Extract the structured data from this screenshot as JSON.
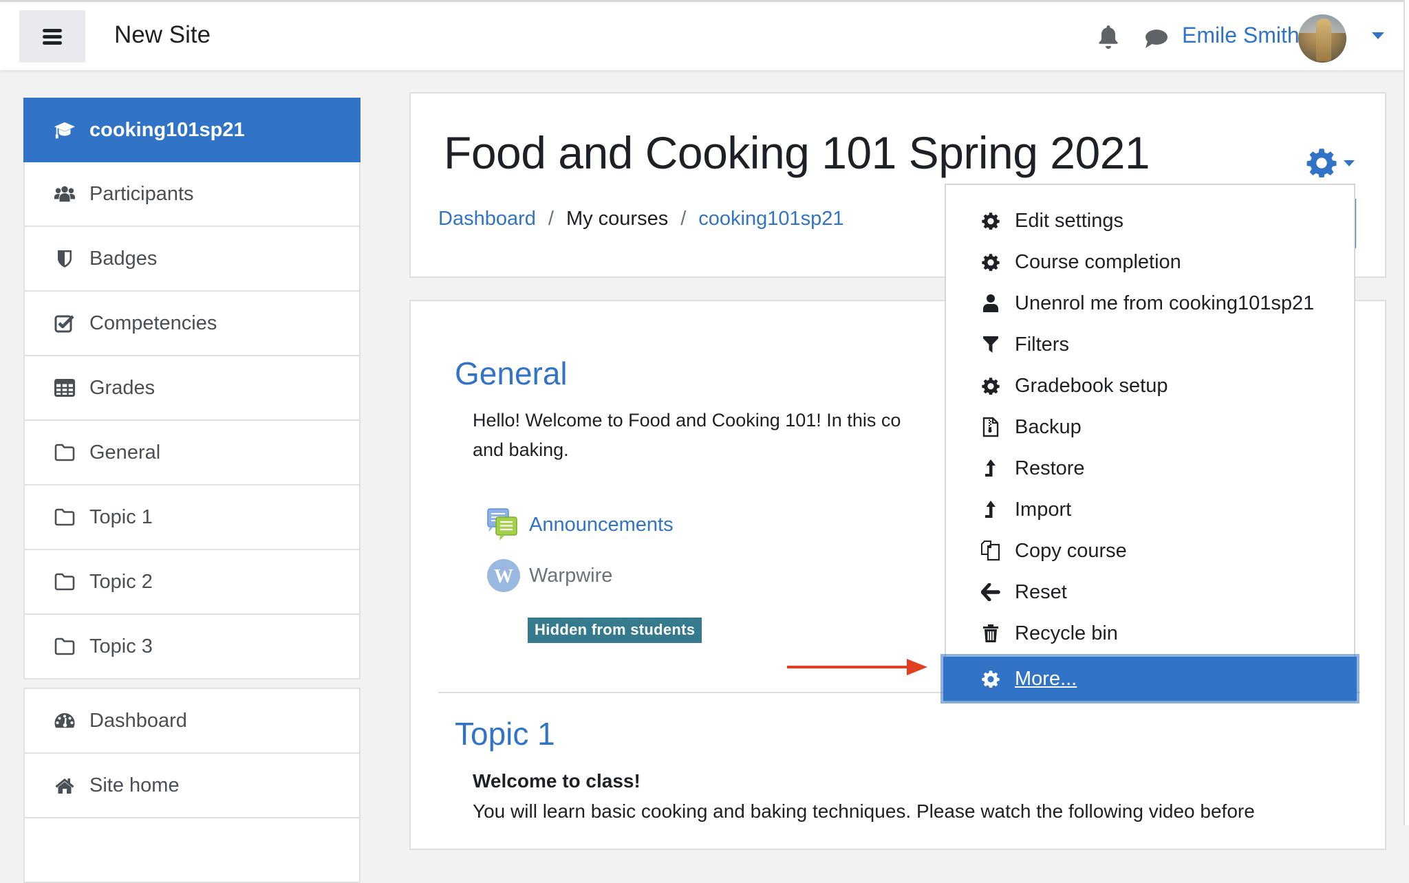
{
  "navbar": {
    "site_name": "New Site",
    "user_name": "Emile Smith",
    "icons": [
      "hamburger-icon",
      "bell-icon",
      "chat-icon",
      "avatar",
      "caret-down-icon"
    ]
  },
  "sidebar": {
    "course_items": [
      {
        "label": "cooking101sp21",
        "icon": "graduation-cap-icon",
        "active": true
      },
      {
        "label": "Participants",
        "icon": "users-icon"
      },
      {
        "label": "Badges",
        "icon": "shield-icon"
      },
      {
        "label": "Competencies",
        "icon": "check-square-icon"
      },
      {
        "label": "Grades",
        "icon": "table-icon"
      },
      {
        "label": "General",
        "icon": "folder-icon"
      },
      {
        "label": "Topic 1",
        "icon": "folder-icon"
      },
      {
        "label": "Topic 2",
        "icon": "folder-icon"
      },
      {
        "label": "Topic 3",
        "icon": "folder-icon"
      }
    ],
    "site_items": [
      {
        "label": "Dashboard",
        "icon": "dashboard-icon"
      },
      {
        "label": "Site home",
        "icon": "home-icon"
      }
    ]
  },
  "header": {
    "title": "Food and Cooking 101 Spring 2021",
    "breadcrumb": [
      {
        "label": "Dashboard",
        "link": true
      },
      {
        "label": "My courses",
        "link": false
      },
      {
        "label": "cooking101sp21",
        "link": true
      }
    ],
    "separator": "/"
  },
  "course_menu": {
    "items": [
      {
        "label": "Edit settings",
        "icon": "gear-icon"
      },
      {
        "label": "Course completion",
        "icon": "gear-icon"
      },
      {
        "label": "Unenrol me from cooking101sp21",
        "icon": "user-icon"
      },
      {
        "label": "Filters",
        "icon": "filter-icon"
      },
      {
        "label": "Gradebook setup",
        "icon": "gear-icon"
      },
      {
        "label": "Backup",
        "icon": "file-archive-icon"
      },
      {
        "label": "Restore",
        "icon": "level-up-icon"
      },
      {
        "label": "Import",
        "icon": "level-up-icon"
      },
      {
        "label": "Copy course",
        "icon": "copy-icon"
      },
      {
        "label": "Reset",
        "icon": "arrow-left-icon"
      },
      {
        "label": "Recycle bin",
        "icon": "trash-icon"
      },
      {
        "label": "More...",
        "icon": "gear-icon",
        "highlighted": true
      }
    ]
  },
  "content": {
    "general": {
      "title": "General",
      "summary_line1": "Hello! Welcome to Food and Cooking 101! In this co",
      "summary_line2": "and baking.",
      "activities": [
        {
          "label": "Announcements",
          "icon": "forum-icon",
          "link": true
        },
        {
          "label": "Warpwire",
          "icon": "warpwire-icon",
          "link": false
        }
      ],
      "hidden_badge": "Hidden from students"
    },
    "topic1": {
      "title": "Topic 1",
      "welcome": "Welcome to class!",
      "text": "You will learn basic cooking and baking techniques. Please watch the following video before"
    }
  },
  "colors": {
    "brand": "#3174c7",
    "badge_info": "#357a8d",
    "annotation_arrow": "#e0401f",
    "text": "#1d2125",
    "muted": "#494f55"
  }
}
